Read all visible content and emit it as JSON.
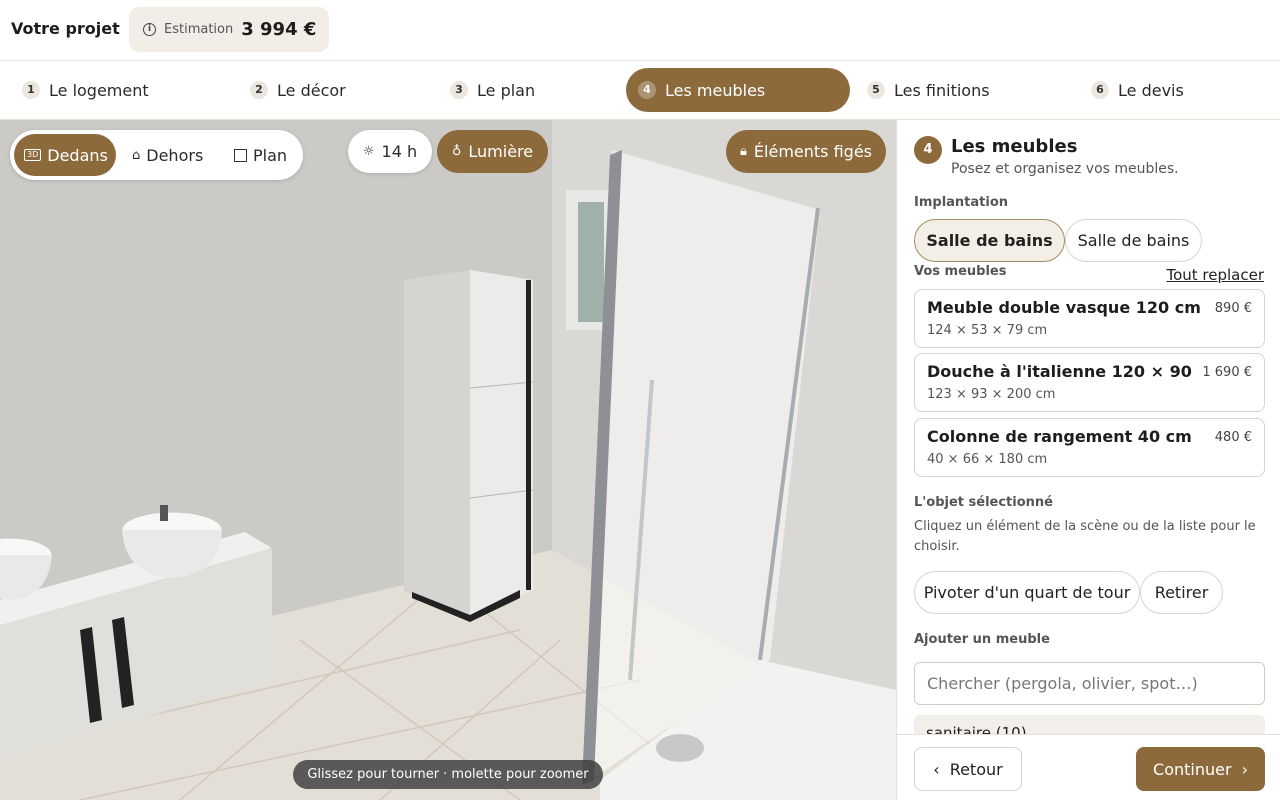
{
  "header": {
    "title": "Votre projet",
    "estimate_label": "Estimation",
    "estimate_value": "3 994 €"
  },
  "steps": [
    {
      "num": "1",
      "label": "Le logement",
      "active": false
    },
    {
      "num": "2",
      "label": "Le décor",
      "active": false
    },
    {
      "num": "3",
      "label": "Le plan",
      "active": false
    },
    {
      "num": "4",
      "label": "Les meubles",
      "active": true
    },
    {
      "num": "5",
      "label": "Les finitions",
      "active": false
    },
    {
      "num": "6",
      "label": "Le devis",
      "active": false
    }
  ],
  "viewport": {
    "views": [
      {
        "icon": "3d-icon",
        "icon_text": "3D",
        "label": "Dedans",
        "active": true
      },
      {
        "icon": "house-icon",
        "label": "Dehors",
        "active": false
      },
      {
        "icon": "plan-icon",
        "label": "Plan",
        "active": false
      }
    ],
    "time_label": "14 h",
    "light_label": "Lumière",
    "lock_label": "Éléments figés",
    "hint": "Glissez pour tourner · molette pour zoomer"
  },
  "panel": {
    "step_num": "4",
    "title": "Les meubles",
    "subtitle": "Posez et organisez vos meubles.",
    "layout_label": "Implantation",
    "layouts": [
      {
        "label": "Salle de bains",
        "selected": true
      },
      {
        "label": "Salle de bains",
        "selected": false
      }
    ],
    "furniture_label": "Vos meubles",
    "replace_all": "Tout replacer",
    "items": [
      {
        "name": "Meuble double vasque 120 cm",
        "price": "890 €",
        "dims": "124 × 53 × 79 cm"
      },
      {
        "name": "Douche à l'italienne 120 × 90",
        "price": "1 690 €",
        "dims": "123 × 93 × 200 cm"
      },
      {
        "name": "Colonne de rangement 40 cm",
        "price": "480 €",
        "dims": "40 × 66 × 180 cm"
      }
    ],
    "selected_label": "L'objet sélectionné",
    "selected_help": "Cliquez un élément de la scène ou de la liste pour le choisir.",
    "rotate_label": "Pivoter d'un quart de tour",
    "remove_label": "Retirer",
    "add_label": "Ajouter un meuble",
    "search_placeholder": "Chercher (pergola, olivier, spot…)",
    "category_partial": "sanitaire (10)"
  },
  "footer": {
    "back_label": "Retour",
    "next_label": "Continuer"
  },
  "colors": {
    "accent": "#8c6a3c",
    "accent_light": "#f4efe6"
  }
}
